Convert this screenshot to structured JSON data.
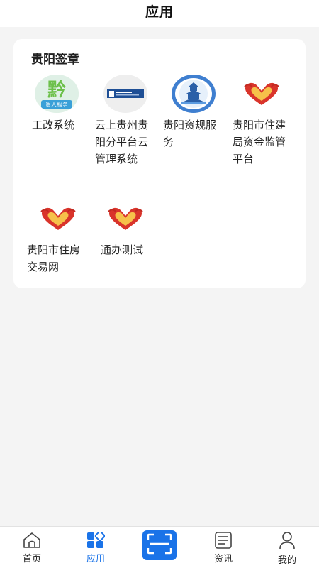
{
  "header": {
    "title": "应用"
  },
  "section": {
    "title": "贵阳签章",
    "apps": [
      {
        "label": "工改系统",
        "icon": "qian-logo-icon",
        "icon_text": "黔",
        "icon_sub": "贵人服务"
      },
      {
        "label": "云上贵州贵阳分平台云管理系统",
        "icon": "cloud-platform-logo-icon"
      },
      {
        "label": "贵阳资规服务",
        "icon": "pavilion-logo-icon"
      },
      {
        "label": "贵阳市住建局资金监管平台",
        "icon": "heart-hands-icon"
      },
      {
        "label": "贵阳市住房交易网",
        "icon": "heart-hands-icon"
      },
      {
        "label": "通办测试",
        "icon": "heart-hands-icon"
      }
    ]
  },
  "tabbar": {
    "items": [
      {
        "label": "首页",
        "icon": "home-icon"
      },
      {
        "label": "应用",
        "icon": "apps-grid-icon"
      },
      {
        "label": "",
        "icon": "scan-icon"
      },
      {
        "label": "资讯",
        "icon": "news-icon"
      },
      {
        "label": "我的",
        "icon": "user-icon"
      }
    ]
  },
  "colors": {
    "accent": "#1a73e8",
    "heart_red": "#d9342b",
    "heart_orange": "#f0a020"
  }
}
